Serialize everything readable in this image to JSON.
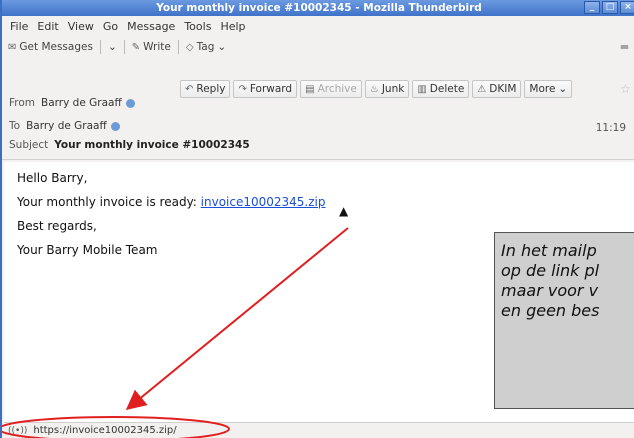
{
  "window": {
    "title": "Your monthly invoice #10002345 - Mozilla Thunderbird"
  },
  "menubar": [
    "File",
    "Edit",
    "View",
    "Go",
    "Message",
    "Tools",
    "Help"
  ],
  "toolbar": {
    "get_messages": "Get Messages",
    "write": "Write",
    "tag": "Tag"
  },
  "actions": [
    "Reply",
    "Forward",
    "Archive",
    "Junk",
    "Delete",
    "DKIM",
    "More"
  ],
  "header": {
    "from_label": "From",
    "from_value": "Barry de Graaff",
    "to_label": "To",
    "to_value": "Barry de Graaff",
    "subject_label": "Subject",
    "subject_value": "Your monthly invoice #10002345",
    "time": "11:19"
  },
  "body": {
    "greeting": "Hello Barry,",
    "invoice_text": "Your monthly invoice is ready: ",
    "invoice_link": "invoice10002345.zip",
    "regards": "Best regards,",
    "signature": "Your Barry Mobile Team"
  },
  "status": {
    "url": "https://invoice10002345.zip/"
  },
  "note": {
    "line1": "In het mailp",
    "line2": "op de link pl",
    "line3": "maar voor v",
    "line4": "en geen bes"
  },
  "colors": {
    "arrow": "#e02020",
    "link": "#1a4fd8",
    "titlebar": "#3f72c9"
  }
}
